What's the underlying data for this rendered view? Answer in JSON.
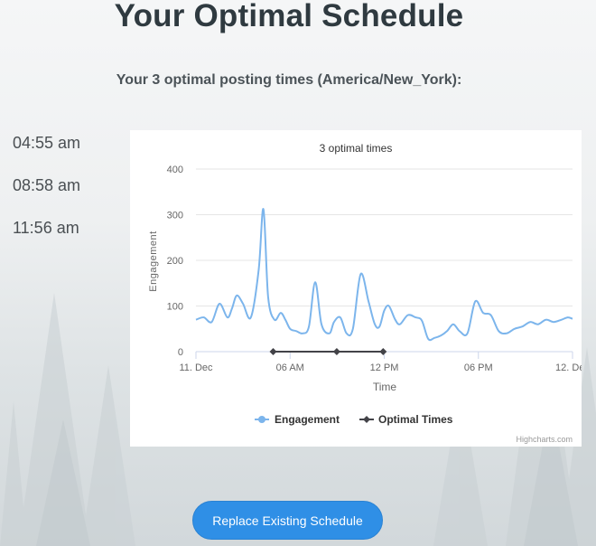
{
  "page": {
    "title": "Your Optimal Schedule",
    "subtitle": "Your 3 optimal posting times (America/New_York):",
    "times": [
      "04:55 am",
      "08:58 am",
      "11:56 am"
    ],
    "button_label": "Replace Existing Schedule"
  },
  "colors": {
    "engagement": "#7cb5ec",
    "optimal": "#434348",
    "button": "#2f8fe6"
  },
  "chart_data": {
    "type": "line",
    "title": "3 optimal times",
    "xlabel": "Time",
    "ylabel": "Engagement",
    "credits": "Highcharts.com",
    "xlim": [
      0,
      24
    ],
    "ylim": [
      0,
      400
    ],
    "y_ticks": [
      0,
      100,
      200,
      300,
      400
    ],
    "x_ticks": [
      {
        "x": 0,
        "label": "11. Dec"
      },
      {
        "x": 6,
        "label": "06 AM"
      },
      {
        "x": 12,
        "label": "12 PM"
      },
      {
        "x": 18,
        "label": "06 PM"
      },
      {
        "x": 24,
        "label": "12. Dec"
      }
    ],
    "grid": true,
    "legend_position": "bottom-center",
    "series": [
      {
        "name": "Engagement",
        "x": [
          0,
          0.5,
          1,
          1.5,
          2,
          2.3,
          2.6,
          3,
          3.5,
          4,
          4.3,
          4.6,
          5,
          5.4,
          5.7,
          6,
          6.4,
          6.8,
          7.2,
          7.6,
          8,
          8.5,
          8.8,
          9.2,
          9.6,
          10,
          10.5,
          11,
          11.4,
          11.7,
          12,
          12.3,
          12.7,
          13,
          13.5,
          14,
          14.4,
          14.8,
          15.2,
          15.6,
          16,
          16.4,
          16.8,
          17.3,
          17.8,
          18.3,
          18.8,
          19.3,
          19.8,
          20.3,
          20.8,
          21.3,
          21.8,
          22.3,
          22.8,
          23.3,
          23.7,
          24
        ],
        "values": [
          70,
          75,
          65,
          105,
          75,
          95,
          123,
          105,
          75,
          180,
          312,
          120,
          70,
          85,
          70,
          50,
          45,
          40,
          55,
          152,
          60,
          40,
          65,
          75,
          40,
          50,
          170,
          110,
          60,
          55,
          90,
          100,
          70,
          60,
          80,
          75,
          68,
          28,
          30,
          35,
          45,
          60,
          45,
          40,
          110,
          85,
          80,
          45,
          40,
          50,
          55,
          65,
          60,
          70,
          65,
          70,
          75,
          72
        ]
      },
      {
        "name": "Optimal Times",
        "x": [
          4.92,
          8.97,
          11.93
        ],
        "values": [
          0,
          0,
          0
        ]
      }
    ]
  }
}
